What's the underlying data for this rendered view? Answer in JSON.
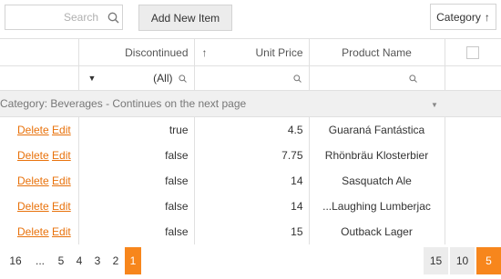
{
  "toolbar": {
    "search_placeholder": "Search",
    "add_button_label": "Add New Item",
    "group_panel_chip": "Category",
    "group_sort_arrow": "↑"
  },
  "columns": {
    "discontinued": "Discontinued",
    "unit_price": "Unit Price",
    "unit_price_sort": "↑",
    "product_name": "Product Name"
  },
  "filter": {
    "discontinued_value": "(All)"
  },
  "group_row": {
    "text": "Category: Beverages - Continues on the next page"
  },
  "commands": {
    "delete": "Delete",
    "edit": "Edit"
  },
  "rows": [
    {
      "discontinued": "true",
      "unit_price": "4.5",
      "product_name": "Guaraná Fantástica"
    },
    {
      "discontinued": "false",
      "unit_price": "7.75",
      "product_name": "Rhönbräu Klosterbier"
    },
    {
      "discontinued": "false",
      "unit_price": "14",
      "product_name": "Sasquatch Ale"
    },
    {
      "discontinued": "false",
      "unit_price": "14",
      "product_name": "...Laughing Lumberjac"
    },
    {
      "discontinued": "false",
      "unit_price": "15",
      "product_name": "Outback Lager"
    }
  ],
  "pager": {
    "pages": [
      "16",
      "...",
      "5",
      "4",
      "3",
      "2",
      "1"
    ],
    "active_page": "1",
    "page_sizes": [
      "15",
      "10",
      "5"
    ],
    "active_page_size": "5"
  },
  "colors": {
    "accent": "#f7861c",
    "link": "#e8710a"
  }
}
